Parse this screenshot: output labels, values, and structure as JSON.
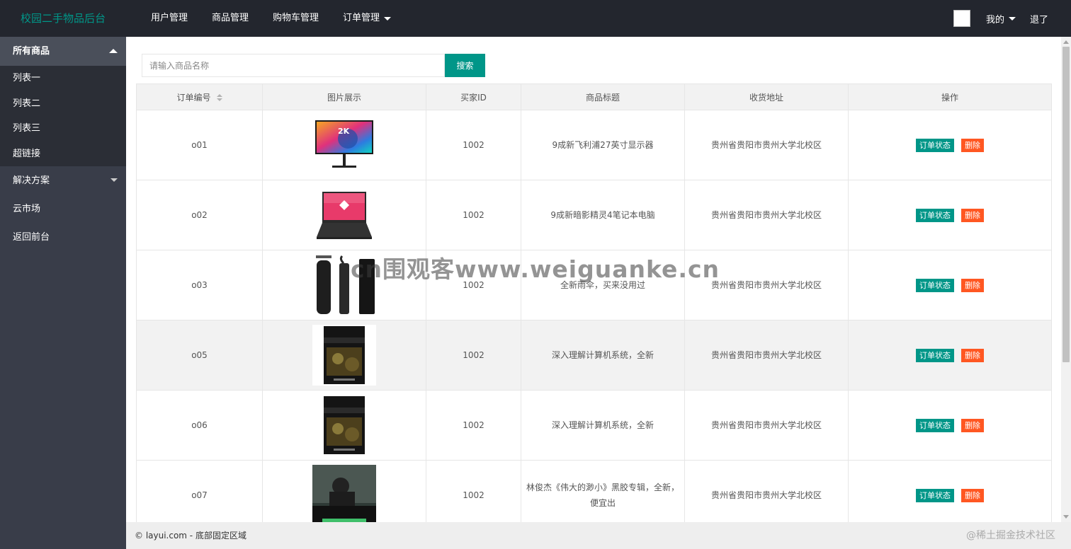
{
  "header": {
    "logo": "校园二手物品后台",
    "nav": [
      {
        "label": "用户管理"
      },
      {
        "label": "商品管理"
      },
      {
        "label": "购物车管理"
      },
      {
        "label": "订单管理"
      }
    ],
    "my_label": "我的",
    "logout_label": "退了"
  },
  "sidebar": {
    "group_all": "所有商品",
    "sub_items": [
      {
        "label": "列表一"
      },
      {
        "label": "列表二"
      },
      {
        "label": "列表三"
      },
      {
        "label": "超链接"
      }
    ],
    "group_solution": "解决方案",
    "links": [
      {
        "label": "云市场"
      },
      {
        "label": "返回前台"
      }
    ]
  },
  "search": {
    "placeholder": "请输入商品名称",
    "button_label": "搜索"
  },
  "table": {
    "columns": [
      "订单编号",
      "图片展示",
      "买家ID",
      "商品标题",
      "收货地址",
      "操作"
    ],
    "status_label": "订单状态",
    "delete_label": "删除",
    "rows": [
      {
        "id": "o01",
        "image": "monitor-image",
        "buyer": "1002",
        "title": "9成新飞利浦27英寸显示器",
        "address": "贵州省贵阳市贵州大学北校区"
      },
      {
        "id": "o02",
        "image": "laptop-image",
        "buyer": "1002",
        "title": "9成新暗影精灵4笔记本电脑",
        "address": "贵州省贵阳市贵州大学北校区"
      },
      {
        "id": "o03",
        "image": "umbrella-image",
        "buyer": "1002",
        "title": "全新雨伞，买来没用过",
        "address": "贵州省贵阳市贵州大学北校区"
      },
      {
        "id": "o05",
        "image": "book-image",
        "buyer": "1002",
        "title": "深入理解计算机系统，全新",
        "address": "贵州省贵阳市贵州大学北校区"
      },
      {
        "id": "o06",
        "image": "book-image",
        "buyer": "1002",
        "title": "深入理解计算机系统，全新",
        "address": "贵州省贵阳市贵州大学北校区"
      },
      {
        "id": "o07",
        "image": "album-image",
        "buyer": "1002",
        "title": "林俊杰《伟大的渺小》黑胶专辑，全新，便宜出",
        "address": "贵州省贵阳市贵州大学北校区"
      }
    ]
  },
  "footer": {
    "text": "© layui.com - 底部固定区域",
    "corner": "@稀土掘金技术社区"
  },
  "watermark": "cn围观客www.weiguanke.cn",
  "colors": {
    "header_bg": "#23262e",
    "sidebar_bg": "#393d49",
    "accent": "#009688",
    "danger": "#ff5722"
  }
}
